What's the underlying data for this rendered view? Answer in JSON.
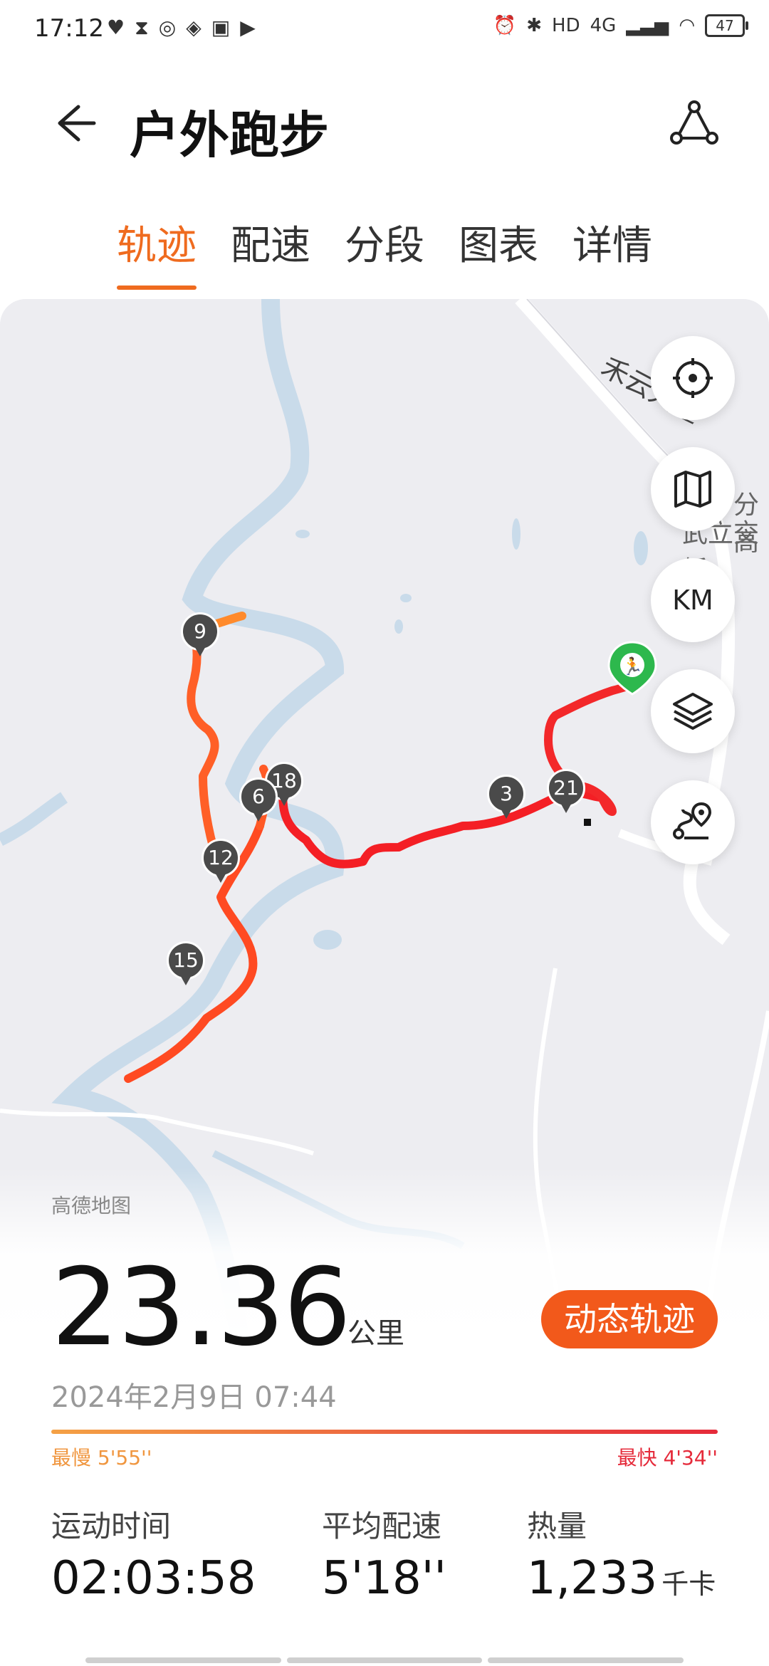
{
  "status_bar": {
    "time": "17:12",
    "network": "4G",
    "battery": "47"
  },
  "header": {
    "title": "户外跑步",
    "back_icon": "arrow-left-icon",
    "share_icon": "share-nodes-icon"
  },
  "tabs": [
    "轨迹",
    "配速",
    "分段",
    "图表",
    "详情"
  ],
  "map": {
    "road_labels": [
      "禾云大道",
      "分高",
      "武立交桥"
    ],
    "map_buttons": [
      "locate-icon",
      "map-icon",
      "KM",
      "layers-icon",
      "route-icon"
    ],
    "km_label": "KM",
    "markers": [
      "9",
      "18",
      "6",
      "12",
      "15",
      "3",
      "21"
    ],
    "provider": "高德地图"
  },
  "summary": {
    "distance": "23.36",
    "distance_unit": "公里",
    "dynamic_track_button": "动态轨迹",
    "datetime": "2024年2月9日 07:44",
    "slowest": "最慢 5'55''",
    "fastest": "最快 4'34''",
    "colors": {
      "accent": "#ef6b1f",
      "slow": "#f0963f",
      "fast": "#e52a3a"
    }
  },
  "stats": [
    {
      "label": "运动时间",
      "value": "02:03:58",
      "unit": ""
    },
    {
      "label": "平均配速",
      "value": "5'18''",
      "unit": ""
    },
    {
      "label": "热量",
      "value": "1,233",
      "unit": "千卡"
    }
  ]
}
